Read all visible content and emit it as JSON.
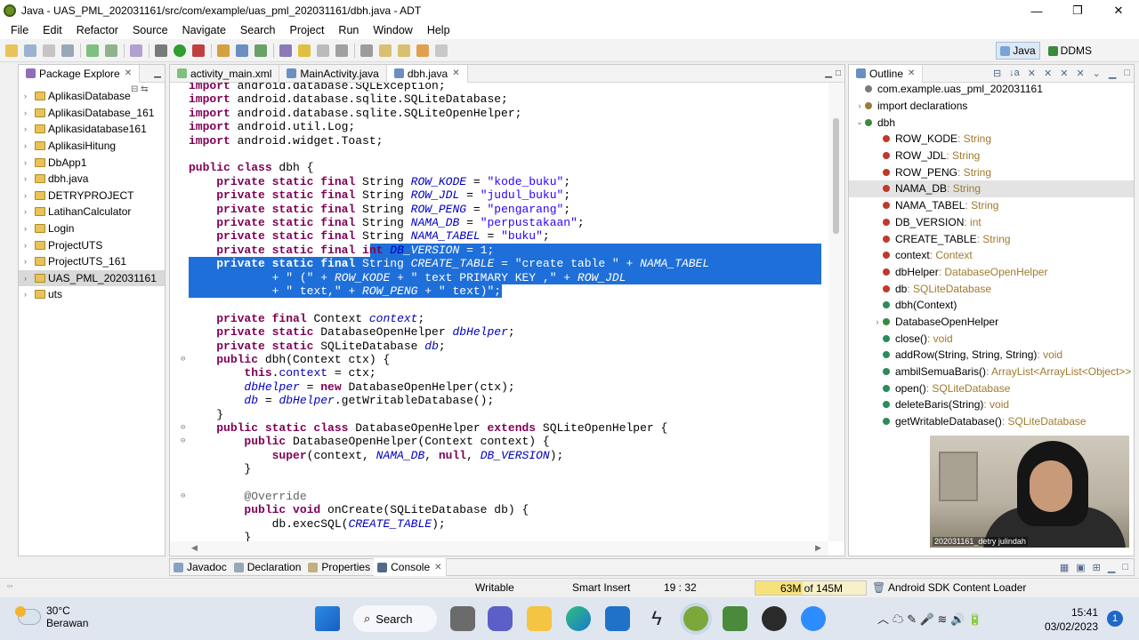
{
  "window": {
    "title": "Java - UAS_PML_202031161/src/com/example/uas_pml_202031161/dbh.java - ADT",
    "minimize": "—",
    "maximize": "❐",
    "close": "✕"
  },
  "menu": [
    "File",
    "Edit",
    "Refactor",
    "Source",
    "Navigate",
    "Search",
    "Project",
    "Run",
    "Window",
    "Help"
  ],
  "perspectives": [
    {
      "label": "Java",
      "active": true,
      "color": "#7aa4d8"
    },
    {
      "label": "DDMS",
      "active": false,
      "color": "#3b8a3b"
    }
  ],
  "package_explorer": {
    "title": "Package Explore",
    "items": [
      {
        "label": "AplikasiDatabase",
        "selected": false
      },
      {
        "label": "AplikasiDatabase_161",
        "selected": false
      },
      {
        "label": "Aplikasidatabase161",
        "selected": false
      },
      {
        "label": "AplikasiHitung",
        "selected": false
      },
      {
        "label": "DbApp1",
        "selected": false
      },
      {
        "label": "dbh.java",
        "selected": false
      },
      {
        "label": "DETRYPROJECT",
        "selected": false
      },
      {
        "label": "LatihanCalculator",
        "selected": false
      },
      {
        "label": "Login",
        "selected": false
      },
      {
        "label": "ProjectUTS",
        "selected": false
      },
      {
        "label": "ProjectUTS_161",
        "selected": false
      },
      {
        "label": "UAS_PML_202031161",
        "selected": true
      },
      {
        "label": "uts",
        "selected": false
      }
    ]
  },
  "editor": {
    "tabs": [
      {
        "label": "activity_main.xml",
        "active": false
      },
      {
        "label": "MainActivity.java",
        "active": false
      },
      {
        "label": "dbh.java",
        "active": true
      }
    ]
  },
  "outline": {
    "title": "Outline",
    "items": [
      {
        "name": "com.example.uas_pml_202031161",
        "type": "",
        "indent": 0,
        "twisty": "",
        "color": "#7a7a7a",
        "selected": false
      },
      {
        "name": "import declarations",
        "type": "",
        "indent": 0,
        "twisty": "›",
        "color": "#9a7b3c",
        "selected": false
      },
      {
        "name": "dbh",
        "type": "",
        "indent": 0,
        "twisty": "⌄",
        "color": "#3b8a3b",
        "selected": false
      },
      {
        "name": "ROW_KODE",
        "type": " : String",
        "indent": 1,
        "twisty": "",
        "color": "#c0392b",
        "selected": false
      },
      {
        "name": "ROW_JDL",
        "type": " : String",
        "indent": 1,
        "twisty": "",
        "color": "#c0392b",
        "selected": false
      },
      {
        "name": "ROW_PENG",
        "type": " : String",
        "indent": 1,
        "twisty": "",
        "color": "#c0392b",
        "selected": false
      },
      {
        "name": "NAMA_DB",
        "type": " : String",
        "indent": 1,
        "twisty": "",
        "color": "#c0392b",
        "selected": true
      },
      {
        "name": "NAMA_TABEL",
        "type": " : String",
        "indent": 1,
        "twisty": "",
        "color": "#c0392b",
        "selected": false
      },
      {
        "name": "DB_VERSION",
        "type": " : int",
        "indent": 1,
        "twisty": "",
        "color": "#c0392b",
        "selected": false
      },
      {
        "name": "CREATE_TABLE",
        "type": " : String",
        "indent": 1,
        "twisty": "",
        "color": "#c0392b",
        "selected": false
      },
      {
        "name": "context",
        "type": " : Context",
        "indent": 1,
        "twisty": "",
        "color": "#c0392b",
        "selected": false
      },
      {
        "name": "dbHelper",
        "type": " : DatabaseOpenHelper",
        "indent": 1,
        "twisty": "",
        "color": "#c0392b",
        "selected": false
      },
      {
        "name": "db",
        "type": " : SQLiteDatabase",
        "indent": 1,
        "twisty": "",
        "color": "#c0392b",
        "selected": false
      },
      {
        "name": "dbh(Context)",
        "type": "",
        "indent": 1,
        "twisty": "",
        "color": "#2e8b57",
        "selected": false
      },
      {
        "name": "DatabaseOpenHelper",
        "type": "",
        "indent": 1,
        "twisty": "›",
        "color": "#3b8a3b",
        "selected": false
      },
      {
        "name": "close()",
        "type": " : void",
        "indent": 1,
        "twisty": "",
        "color": "#2e8b57",
        "selected": false
      },
      {
        "name": "addRow(String, String, String)",
        "type": " : void",
        "indent": 1,
        "twisty": "",
        "color": "#2e8b57",
        "selected": false
      },
      {
        "name": "ambilSemuaBaris()",
        "type": " : ArrayList<ArrayList<Object>>",
        "indent": 1,
        "twisty": "",
        "color": "#2e8b57",
        "selected": false
      },
      {
        "name": "open()",
        "type": " : SQLiteDatabase",
        "indent": 1,
        "twisty": "",
        "color": "#2e8b57",
        "selected": false
      },
      {
        "name": "deleteBaris(String)",
        "type": " : void",
        "indent": 1,
        "twisty": "",
        "color": "#2e8b57",
        "selected": false
      },
      {
        "name": "getWritableDatabase()",
        "type": " : SQLiteDatabase",
        "indent": 1,
        "twisty": "",
        "color": "#2e8b57",
        "selected": false
      }
    ]
  },
  "code_lines": [
    {
      "html": "<span class=\"kw\">import</span> android.database.SQLException;"
    },
    {
      "html": "<span class=\"kw\">import</span> android.database.sqlite.SQLiteDatabase;"
    },
    {
      "html": "<span class=\"kw\">import</span> android.database.sqlite.SQLiteOpenHelper;"
    },
    {
      "html": "<span class=\"kw\">import</span> android.util.Log;"
    },
    {
      "html": "<span class=\"kw\">import</span> android.widget.Toast;"
    },
    {
      "html": ""
    },
    {
      "html": "<span class=\"kw\">public class</span> dbh {"
    },
    {
      "html": "    <span class=\"kw\">private static final</span> String <span class=\"fd\">ROW_KODE</span> = <span class=\"st\">\"kode_buku\"</span>;"
    },
    {
      "html": "    <span class=\"kw\">private static final</span> String <span class=\"fd\">ROW_JDL</span> = <span class=\"st\">\"judul_buku\"</span>;"
    },
    {
      "html": "    <span class=\"kw\">private static final</span> String <span class=\"fd\">ROW_PENG</span> = <span class=\"st\">\"pengarang\"</span>;"
    },
    {
      "html": "    <span class=\"kw\">private static final</span> String <span class=\"fd\">NAMA_DB</span> = <span class=\"st\">\"perpustakaan\"</span>;"
    },
    {
      "html": "    <span class=\"kw\">private static final</span> String <span class=\"fd\">NAMA_TABEL</span> = <span class=\"st\">\"buku\"</span>;"
    },
    {
      "html": "    <span class=\"kw\">private static final int</span> <span class=\"fd\">DB</span><span class=\"sel-t\"><span class=\"fd\">_VERSION</span> = 1;</span>",
      "sel_from": 26
    },
    {
      "html": "<span class=\"sel-t\">    <span class=\"kw\">private static final</span> String <span class=\"fd\">CREATE_TABLE</span> = <span class=\"st\">\"create table \"</span> + <span class=\"fd\">NAMA_TABEL</span></span>",
      "sel_full": true
    },
    {
      "html": "<span class=\"sel-t\">            + <span class=\"st\">\" (\"</span> + <span class=\"fd\">ROW_KODE</span> + <span class=\"st\">\" text PRIMARY KEY ,\"</span> + <span class=\"fd\">ROW_JDL</span></span>",
      "sel_full": true
    },
    {
      "html": "<span class=\"sel-t\">            + <span class=\"st\">\" text,\"</span> + <span class=\"fd\">ROW_PENG</span> + <span class=\"st\">\" text)\"</span>;</span>",
      "sel_partial": 45
    },
    {
      "html": ""
    },
    {
      "html": "    <span class=\"kw\">private final</span> Context <span class=\"fd\">context</span>;"
    },
    {
      "html": "    <span class=\"kw\">private static</span> DatabaseOpenHelper <span class=\"fd\">dbHelper</span>;"
    },
    {
      "html": "    <span class=\"kw\">private static</span> SQLiteDatabase <span class=\"fd\">db</span>;"
    },
    {
      "html": "    <span class=\"kw\">public</span> dbh(Context ctx) {",
      "fold": true
    },
    {
      "html": "        <span class=\"kw\">this</span>.<span class=\"fd\" style=\"font-style:normal\">context</span> = ctx;"
    },
    {
      "html": "        <span class=\"fd\">dbHelper</span> = <span class=\"kw\">new</span> DatabaseOpenHelper(ctx);"
    },
    {
      "html": "        <span class=\"fd\">db</span> = <span class=\"fd\">dbHelper</span>.getWritableDatabase();"
    },
    {
      "html": "    }"
    },
    {
      "html": "    <span class=\"kw\">public static class</span> DatabaseOpenHelper <span class=\"kw\">extends</span> SQLiteOpenHelper {",
      "fold": true
    },
    {
      "html": "        <span class=\"kw\">public</span> DatabaseOpenHelper(Context context) {",
      "fold": true
    },
    {
      "html": "            <span class=\"kw\">super</span>(context, <span class=\"fd\">NAMA_DB</span>, <span class=\"kw\">null</span>, <span class=\"fd\">DB_VERSION</span>);"
    },
    {
      "html": "        }"
    },
    {
      "html": ""
    },
    {
      "html": "        <span class=\"an\">@Override</span>",
      "fold": true
    },
    {
      "html": "        <span class=\"kw\">public void</span> onCreate(SQLiteDatabase db) {"
    },
    {
      "html": "            db.execSQL(<span class=\"fd\">CREATE_TABLE</span>);"
    },
    {
      "html": "        }"
    }
  ],
  "bottom_tabs": [
    {
      "label": "Javadoc",
      "active": false
    },
    {
      "label": "Declaration",
      "active": false
    },
    {
      "label": "Properties",
      "active": false
    },
    {
      "label": "Console",
      "active": true
    }
  ],
  "status": {
    "mode": "Writable",
    "insert": "Smart Insert",
    "position": "19 : 32",
    "memory": "63M of 145M",
    "memory_used_fraction": 0.43,
    "task": "Android SDK Content Loader"
  },
  "webcam": {
    "label": "202031161_detry julindah"
  },
  "taskbar": {
    "temperature": "30°C",
    "weather": "Berawan",
    "search": "Search",
    "time": "15:41",
    "date": "03/02/2023",
    "notifications": "1",
    "tray_icons": "︿ ☁ ✎ 🎤 ≋ 🔊 🔋"
  }
}
